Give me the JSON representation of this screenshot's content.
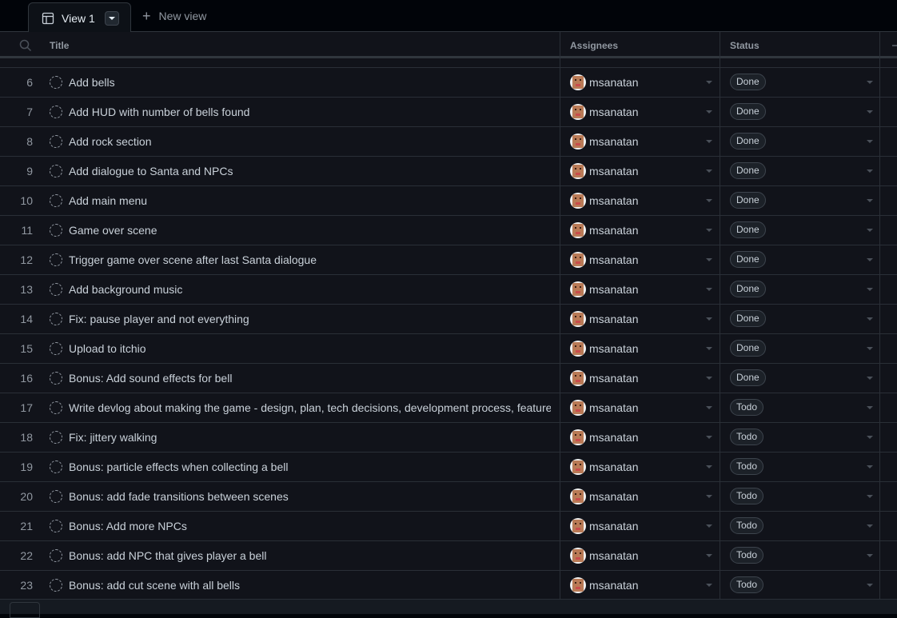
{
  "tabs": {
    "active_label": "View 1",
    "new_view_label": "New view"
  },
  "columns": {
    "title": "Title",
    "assignees": "Assignees",
    "status": "Status"
  },
  "rows": [
    {
      "num": "6",
      "title": "Add bells",
      "assignee": "msanatan",
      "status": "Done"
    },
    {
      "num": "7",
      "title": "Add HUD with number of bells found",
      "assignee": "msanatan",
      "status": "Done"
    },
    {
      "num": "8",
      "title": "Add rock section",
      "assignee": "msanatan",
      "status": "Done"
    },
    {
      "num": "9",
      "title": "Add dialogue to Santa and NPCs",
      "assignee": "msanatan",
      "status": "Done"
    },
    {
      "num": "10",
      "title": "Add main menu",
      "assignee": "msanatan",
      "status": "Done"
    },
    {
      "num": "11",
      "title": "Game over scene",
      "assignee": "msanatan",
      "status": "Done"
    },
    {
      "num": "12",
      "title": "Trigger game over scene after last Santa dialogue",
      "assignee": "msanatan",
      "status": "Done"
    },
    {
      "num": "13",
      "title": "Add background music",
      "assignee": "msanatan",
      "status": "Done"
    },
    {
      "num": "14",
      "title": "Fix: pause player and not everything",
      "assignee": "msanatan",
      "status": "Done"
    },
    {
      "num": "15",
      "title": "Upload to itchio",
      "assignee": "msanatan",
      "status": "Done"
    },
    {
      "num": "16",
      "title": "Bonus: Add sound effects for bell",
      "assignee": "msanatan",
      "status": "Done"
    },
    {
      "num": "17",
      "title": "Write devlog about making the game - design, plan, tech decisions, development process, features",
      "assignee": "msanatan",
      "status": "Todo"
    },
    {
      "num": "18",
      "title": "Fix: jittery walking",
      "assignee": "msanatan",
      "status": "Todo"
    },
    {
      "num": "19",
      "title": "Bonus: particle effects when collecting a bell",
      "assignee": "msanatan",
      "status": "Todo"
    },
    {
      "num": "20",
      "title": "Bonus: add fade transitions between scenes",
      "assignee": "msanatan",
      "status": "Todo"
    },
    {
      "num": "21",
      "title": "Bonus: Add more NPCs",
      "assignee": "msanatan",
      "status": "Todo"
    },
    {
      "num": "22",
      "title": "Bonus: add NPC that gives player a bell",
      "assignee": "msanatan",
      "status": "Todo"
    },
    {
      "num": "23",
      "title": "Bonus: add cut scene with all bells",
      "assignee": "msanatan",
      "status": "Todo"
    }
  ]
}
